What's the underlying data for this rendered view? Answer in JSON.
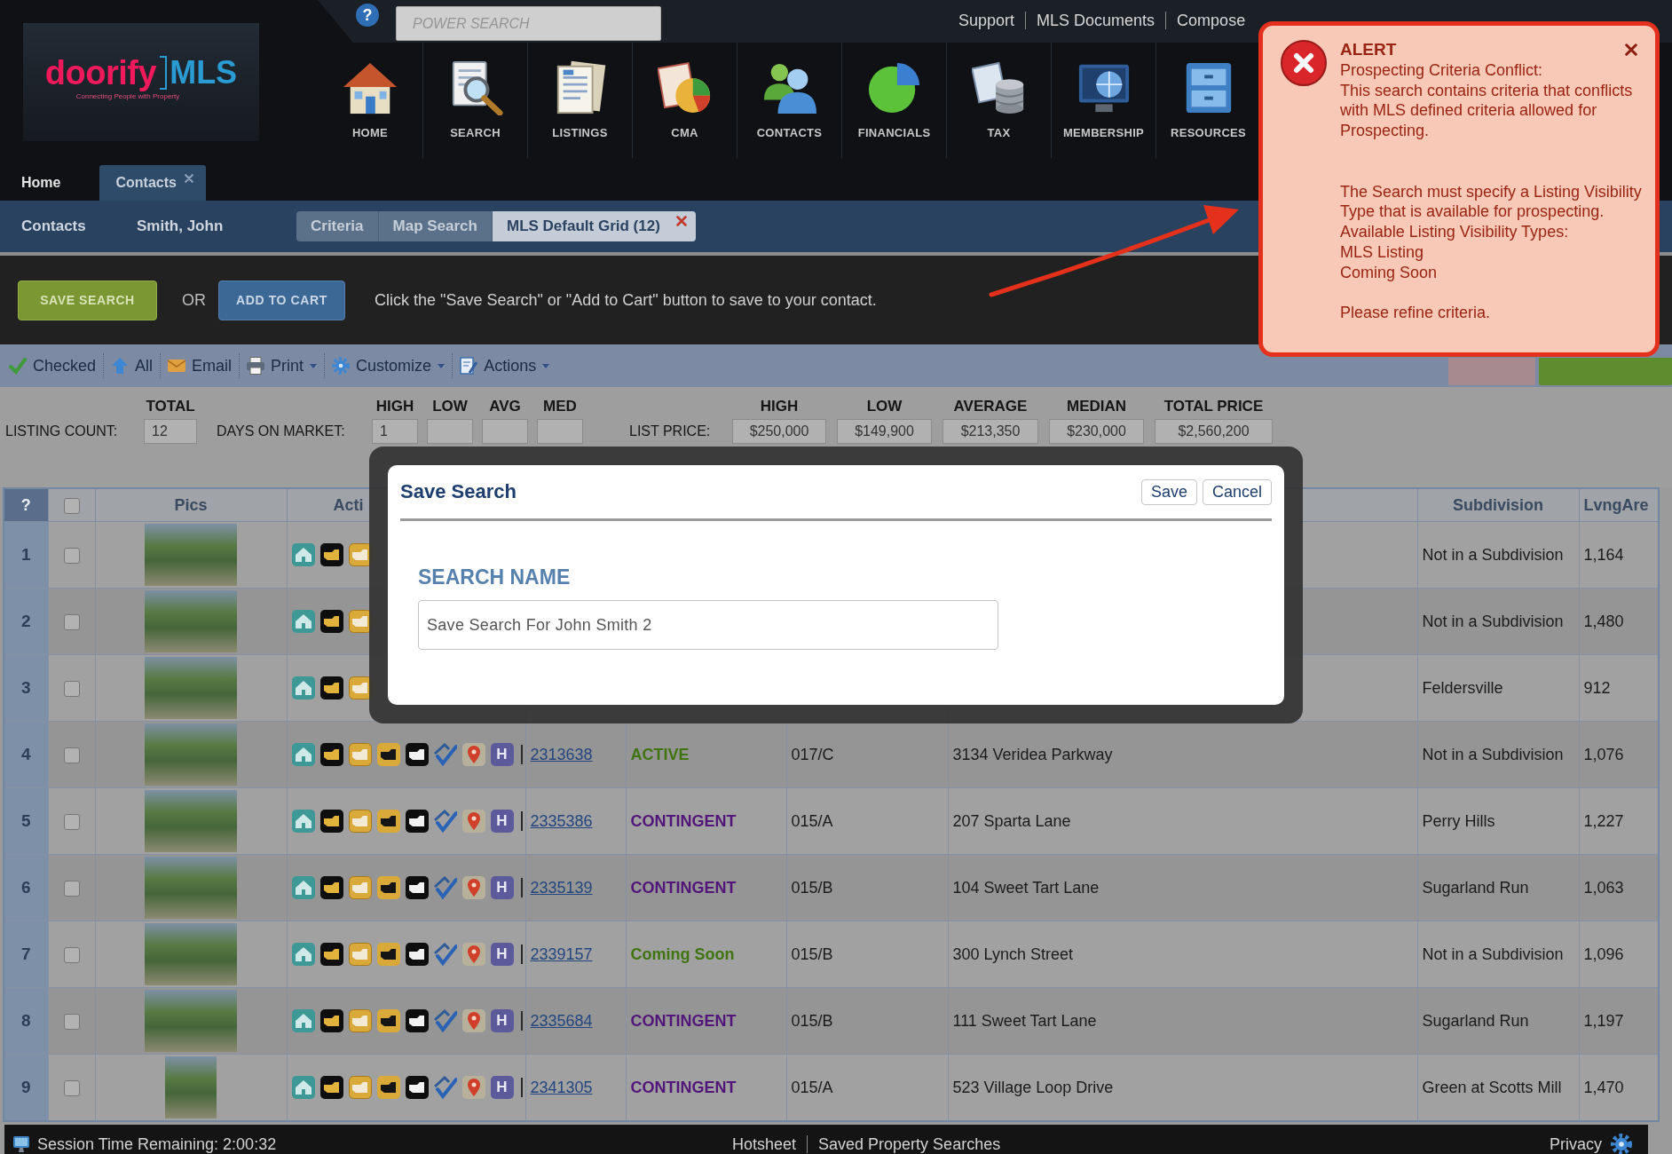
{
  "header": {
    "logo": {
      "brand": "doorify",
      "product": "MLS",
      "tagline": "Connecting People with Property"
    },
    "help_button": "?",
    "search": {
      "placeholder": "POWER SEARCH"
    },
    "links": [
      "Support",
      "MLS Documents",
      "Compose"
    ],
    "nav": [
      {
        "label": "HOME",
        "kind": "house"
      },
      {
        "label": "SEARCH",
        "kind": "search"
      },
      {
        "label": "LISTINGS",
        "kind": "listings"
      },
      {
        "label": "CMA",
        "kind": "cma"
      },
      {
        "label": "CONTACTS",
        "kind": "contacts"
      },
      {
        "label": "FINANCIALS",
        "kind": "financials"
      },
      {
        "label": "TAX",
        "kind": "tax"
      },
      {
        "label": "MEMBERSHIP",
        "kind": "membership"
      },
      {
        "label": "RESOURCES",
        "kind": "resources"
      }
    ],
    "tabs": [
      {
        "label": "Home",
        "selected": false,
        "closable": false
      },
      {
        "label": "Contacts",
        "selected": true,
        "closable": true
      }
    ]
  },
  "breadcrumb": {
    "section": "Contacts",
    "contact": "Smith, John",
    "tabs": [
      {
        "label": "Criteria",
        "selected": false,
        "closable": false
      },
      {
        "label": "Map Search",
        "selected": false,
        "closable": false
      },
      {
        "label": "MLS Default Grid (12)",
        "selected": true,
        "closable": true
      }
    ]
  },
  "action_bar": {
    "save_button": "SAVE SEARCH",
    "separator": "OR",
    "cart_button": "ADD TO CART",
    "hint": "Click the \"Save Search\" or \"Add to Cart\" button to save to your contact."
  },
  "toolbar": {
    "items": [
      {
        "label": "Checked",
        "kind": "check",
        "dropdown": false
      },
      {
        "label": "All",
        "kind": "up",
        "dropdown": false
      },
      {
        "label": "Email",
        "kind": "email",
        "dropdown": false
      },
      {
        "label": "Print",
        "kind": "print",
        "dropdown": true
      },
      {
        "label": "Customize",
        "kind": "customize",
        "dropdown": true
      },
      {
        "label": "Actions",
        "kind": "actions",
        "dropdown": true
      }
    ],
    "right_buttons": [
      {
        "color": "#a68a8f"
      },
      {
        "color": "#5e8c2f"
      }
    ]
  },
  "stats": {
    "listing_count": {
      "header": "TOTAL",
      "label": "LISTING COUNT:",
      "value": "12"
    },
    "days_on_market": {
      "label": "DAYS ON MARKET:",
      "fields": [
        {
          "header": "HIGH",
          "value": "1"
        },
        {
          "header": "LOW"
        },
        {
          "header": "AVG"
        },
        {
          "header": "MED"
        }
      ]
    },
    "list_price": {
      "label": "LIST PRICE:",
      "fields": [
        {
          "header": "HIGH",
          "value": "$250,000"
        },
        {
          "header": "LOW",
          "value": "$149,900"
        },
        {
          "header": "AVERAGE",
          "value": "$213,350"
        },
        {
          "header": "MEDIAN",
          "value": "$230,000"
        },
        {
          "header": "TOTAL PRICE",
          "value": "$2,560,200"
        }
      ]
    }
  },
  "grid": {
    "select_all_checked": false,
    "columns": {
      "number": "?",
      "pics": "Pics",
      "actions": "Acti",
      "subdivision": "Subdivision",
      "living_area": "LvngAre"
    },
    "rows": [
      {
        "number": "1",
        "checked": false,
        "kind": "landscape",
        "subdivision": "Not in a Subdivision",
        "living_area": "1,164"
      },
      {
        "number": "2",
        "checked": false,
        "kind": "landscape",
        "subdivision": "Not in a Subdivision",
        "living_area": "1,480"
      },
      {
        "number": "3",
        "checked": false,
        "kind": "landscape",
        "subdivision": "Feldersville",
        "living_area": "912"
      },
      {
        "number": "4",
        "checked": false,
        "kind": "landscape",
        "badge": "H",
        "ml_number": "2313638",
        "status": "ACTIVE",
        "color": "#3f7410",
        "area": "017/C",
        "address": "3134 Veridea Parkway",
        "subdivision": "Not in a Subdivision",
        "living_area": "1,076"
      },
      {
        "number": "5",
        "checked": false,
        "kind": "landscape",
        "badge": "H",
        "ml_number": "2335386",
        "status": "CONTINGENT",
        "color": "#52157a",
        "area": "015/A",
        "address": "207 Sparta Lane",
        "subdivision": "Perry Hills",
        "living_area": "1,227"
      },
      {
        "number": "6",
        "checked": false,
        "kind": "landscape",
        "badge": "H",
        "ml_number": "2335139",
        "status": "CONTINGENT",
        "color": "#52157a",
        "area": "015/B",
        "address": "104 Sweet Tart Lane",
        "subdivision": "Sugarland Run",
        "living_area": "1,063"
      },
      {
        "number": "7",
        "checked": false,
        "kind": "landscape",
        "badge": "H",
        "ml_number": "2339157",
        "status": "Coming Soon",
        "color": "#3f7410",
        "area": "015/B",
        "address": "300 Lynch Street",
        "subdivision": "Not in a Subdivision",
        "living_area": "1,096"
      },
      {
        "number": "8",
        "checked": false,
        "kind": "landscape",
        "badge": "H",
        "ml_number": "2335684",
        "status": "CONTINGENT",
        "color": "#52157a",
        "area": "015/B",
        "address": "111 Sweet Tart Lane",
        "subdivision": "Sugarland Run",
        "living_area": "1,197"
      },
      {
        "number": "9",
        "checked": false,
        "kind": "portrait",
        "badge": "H",
        "ml_number": "2341305",
        "status": "CONTINGENT",
        "color": "#52157a",
        "area": "015/A",
        "address": "523 Village Loop Drive",
        "subdivision": "Green at Scotts Mill",
        "living_area": "1,470"
      }
    ]
  },
  "footer": {
    "session": "Session Time Remaining: 2:00:32",
    "links": [
      "Hotsheet",
      "Saved Property Searches"
    ],
    "privacy": "Privacy"
  },
  "alert": {
    "title": "ALERT",
    "paragraphs": [
      [
        "Prospecting Criteria Conflict:",
        "This search contains criteria that conflicts with MLS defined criteria allowed for Prospecting."
      ],
      [
        "The Search must specify a Listing Visibility Type that is available for prospecting.",
        "Available Listing Visibility Types:",
        "MLS Listing",
        "Coming Soon"
      ],
      [
        "Please refine criteria."
      ]
    ]
  },
  "dialog": {
    "title": "Save Search",
    "buttons": [
      "Save",
      "Cancel"
    ],
    "field_label": "SEARCH NAME",
    "field_value": "Save Search For John Smith 2"
  }
}
